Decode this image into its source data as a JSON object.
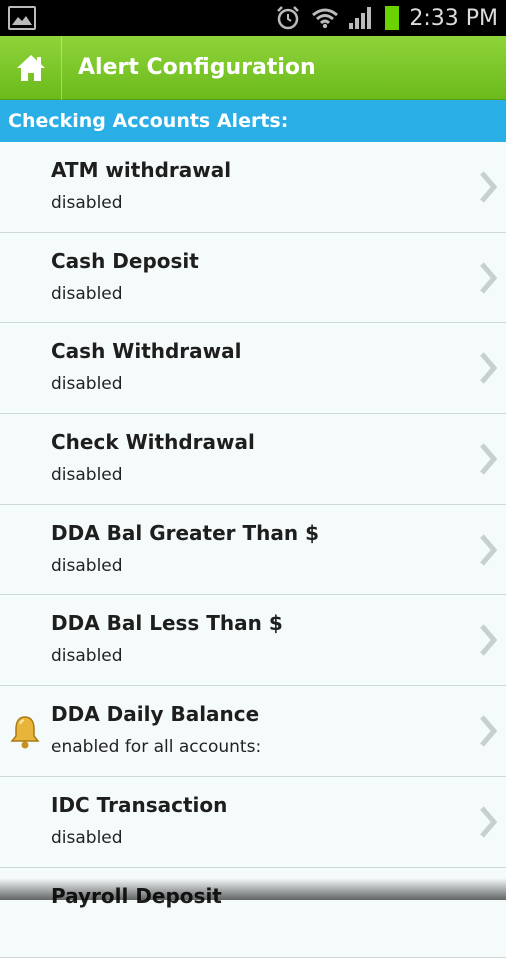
{
  "status_bar": {
    "time": "2:33 PM"
  },
  "header": {
    "title": "Alert Configuration"
  },
  "section": {
    "title": "Checking Accounts Alerts:"
  },
  "alerts": [
    {
      "title": "ATM withdrawal",
      "status": "disabled"
    },
    {
      "title": "Cash Deposit",
      "status": "disabled"
    },
    {
      "title": "Cash Withdrawal",
      "status": "disabled"
    },
    {
      "title": "Check Withdrawal",
      "status": "disabled"
    },
    {
      "title": "DDA Bal Greater Than $",
      "status": "disabled"
    },
    {
      "title": "DDA Bal Less Than $",
      "status": "disabled"
    },
    {
      "title": "DDA Daily Balance",
      "status": "enabled for all accounts:",
      "icon": "bell-icon"
    },
    {
      "title": "IDC Transaction",
      "status": "disabled"
    },
    {
      "title": "Payroll Deposit",
      "status": ""
    }
  ],
  "colors": {
    "header_green": "#7ec82c",
    "section_blue": "#29aee6",
    "battery_green": "#6ad200"
  }
}
